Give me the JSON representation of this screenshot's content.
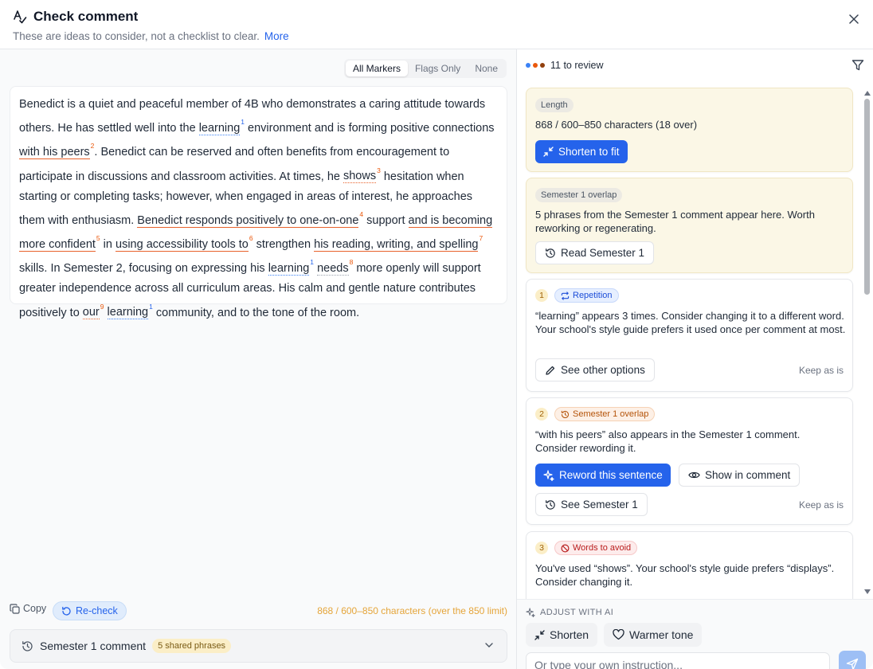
{
  "header": {
    "title": "Check comment",
    "subtitle": "These are ideas to consider, not a checklist to clear.",
    "more_label": "More"
  },
  "markers": {
    "options": [
      "All Markers",
      "Flags Only",
      "None"
    ],
    "selected": "All Markers"
  },
  "comment": {
    "t1": "Benedict is a quiet and peaceful member of 4B who demonstrates a caring attitude towards others. He has settled well into the ",
    "m1": "learning",
    "n1": "1",
    "t2": " environment and is forming positive connections ",
    "m2": "with his peers",
    "n2": "2",
    "t3": ". Benedict can be reserved and often benefits from encouragement to participate in discussions and classroom activities. At times, he ",
    "m3": "shows",
    "n3": "3",
    "t4": " hesitation when starting or completing tasks; however, when engaged in areas of interest, he approaches them with enthusiasm. ",
    "m4": "Benedict responds positively to one-on-one",
    "n4": "4",
    "t5": " support ",
    "m5": "and is becoming more confident",
    "n5": "5",
    "t6": " in ",
    "m6": "using accessibility tools to",
    "n6": "6",
    "t7": " strengthen ",
    "m7": "his reading, writing, and spelling",
    "n7": "7",
    "t8": " skills. In Semester 2, focusing on expressing his ",
    "m8": "learning",
    "n8": "1",
    "t9": " ",
    "m9": "needs",
    "n9": "8",
    "t10": " more openly will support greater independence across all curriculum areas. His calm and gentle nature contributes positively to ",
    "m10": "our",
    "n10": "9",
    "t11": " ",
    "m11": "learning",
    "n11": "1",
    "t12": " community, and to the tone of the room."
  },
  "left_footer": {
    "copy_label": "Copy",
    "recheck_label": "Re-check",
    "charcount": "868 / 600–850 characters (over the 850 limit)"
  },
  "semester_bar": {
    "label": "Semester 1 comment",
    "badge": "5 shared phrases"
  },
  "review": {
    "count_label": "11 to review",
    "dot_colors": [
      "#3b82f6",
      "#ea580c",
      "#92400e"
    ]
  },
  "cards": {
    "length": {
      "chip": "Length",
      "text": "868 / 600–850 characters (18 over)",
      "button": "Shorten to fit"
    },
    "overlap": {
      "chip": "Semester 1 overlap",
      "text": "5 phrases from the Semester 1 comment appear here. Worth reworking or regenerating.",
      "button": "Read Semester 1"
    },
    "c1": {
      "num": "1",
      "tag": "Repetition",
      "text": "“learning” appears 3 times. Consider changing it to a different word. Your school's style guide prefers it used once per comment at most.",
      "button": "See other options",
      "keep": "Keep as is"
    },
    "c2": {
      "num": "2",
      "tag": "Semester 1 overlap",
      "text": "“with his peers” also appears in the Semester 1 comment. Consider rewording it.",
      "button_primary": "Reword this sentence",
      "button_show": "Show in comment",
      "button_see": "See Semester 1",
      "keep": "Keep as is"
    },
    "c3": {
      "num": "3",
      "tag": "Words to avoid",
      "text": "You've used “shows”. Your school's style guide prefers “displays”. Consider changing it."
    }
  },
  "adjust": {
    "label": "ADJUST WITH AI",
    "shorten": "Shorten",
    "warmer": "Warmer tone",
    "placeholder": "Or type your own instruction..."
  },
  "colors": {
    "accent": "#2563eb",
    "repetition": "#3b82f6",
    "overlap": "#e8622c",
    "warning_text": "#e5a53a"
  }
}
